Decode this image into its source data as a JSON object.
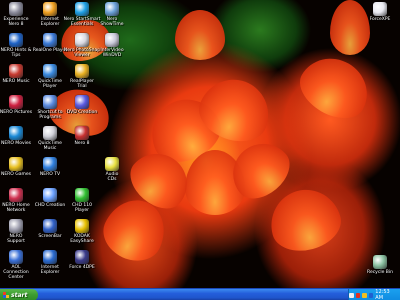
{
  "desktop": {
    "icons": [
      {
        "label": "Experience\nNero 8",
        "color": "#8c8c9c"
      },
      {
        "label": "Internet\nExplorer",
        "color": "#f0a020"
      },
      {
        "label": "Nero StartSmart\nEssentials",
        "color": "#1ea0e6"
      },
      {
        "label": "Nero\nShowTime",
        "color": "#6aa0d8"
      },
      {
        "label": "NERO Hints &\nTips",
        "color": "#1e63c8"
      },
      {
        "label": "RealOne Player",
        "color": "#3a7ad8"
      },
      {
        "label": "Nero PhotoSnap\nViewer",
        "color": "#d8d8e0"
      },
      {
        "label": "InterVideo\nWinDVD",
        "color": "#c8c8d8"
      },
      {
        "label": "NERO Music",
        "color": "#c83a30"
      },
      {
        "label": "QuickTime\nPlayer",
        "color": "#3a8ae0"
      },
      {
        "label": "RealPlayer\nTrial",
        "color": "#e8b020"
      },
      {
        "label": "NERO Pictures",
        "color": "#d02040"
      },
      {
        "label": "Shortcut to\nPrograms",
        "color": "#5a8ae0"
      },
      {
        "label": "DVD Creation",
        "color": "#5a5ae0"
      },
      {
        "label": "NERO Movies",
        "color": "#1a8ad8"
      },
      {
        "label": "QuickTime\nMusic",
        "color": "#d0d0d8"
      },
      {
        "label": "Nero 8",
        "color": "#c83030"
      },
      {
        "label": "NERO Games",
        "color": "#e8c020"
      },
      {
        "label": "NERO TV",
        "color": "#3080e0"
      },
      {
        "label": "Audio\nCDs",
        "color": "#e8e040"
      },
      {
        "label": "NERO Home\nNetwork",
        "color": "#d03050"
      },
      {
        "label": "CHD Creation",
        "color": "#6aa0ff"
      },
      {
        "label": "CHD 110\nPlayer",
        "color": "#30c030"
      },
      {
        "label": "NERO\nSupport",
        "color": "#a0a0b0"
      },
      {
        "label": "ScreenBar",
        "color": "#3060c8"
      },
      {
        "label": "KODAK EasyShare",
        "color": "#e8c000"
      },
      {
        "label": "AOL\nConnection\nCenter",
        "color": "#3a70d8"
      },
      {
        "label": "Internet\nExplorer",
        "color": "#2a6ad0"
      },
      {
        "label": "Force 4DPE",
        "color": "#3a3a8a"
      },
      {
        "label": "ForceXPE",
        "color": "#e8e8f0"
      },
      {
        "label": "Recycle Bin",
        "color": "#8ac0a0"
      }
    ]
  },
  "taskbar": {
    "start_label": "start",
    "clock": "12:53 AM",
    "start_logo_colors": [
      "#f04020",
      "#30b030",
      "#2060e0",
      "#f0c020"
    ],
    "tray_icon_colors": [
      "#f0f0f0",
      "#e03020",
      "#f0c020",
      "#2060d0"
    ]
  }
}
